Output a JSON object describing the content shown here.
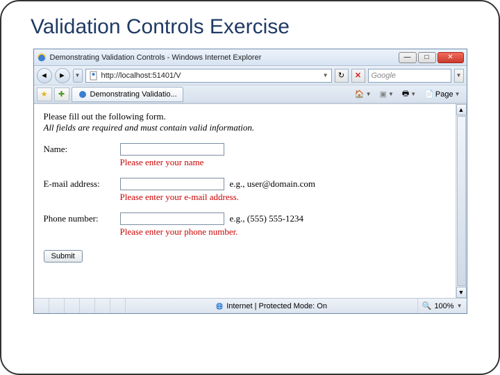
{
  "slide": {
    "title": "Validation Controls Exercise"
  },
  "window": {
    "title": "Demonstrating Validation Controls - Windows Internet Explorer",
    "url": "http://localhost:51401/V",
    "search_placeholder": "Google",
    "tab_label": "Demonstrating Validatio...",
    "page_menu": "Page"
  },
  "page": {
    "instruction1": "Please fill out the following form.",
    "instruction2": "All fields are required and must contain valid information.",
    "fields": {
      "name": {
        "label": "Name:",
        "error": "Please enter your name"
      },
      "email": {
        "label": "E-mail address:",
        "hint": "e.g., user@domain.com",
        "error": "Please enter your e-mail address."
      },
      "phone": {
        "label": "Phone number:",
        "hint": "e.g., (555) 555-1234",
        "error": "Please enter your phone number."
      }
    },
    "submit": "Submit"
  },
  "status": {
    "zone": "Internet | Protected Mode: On",
    "zoom": "100%"
  }
}
